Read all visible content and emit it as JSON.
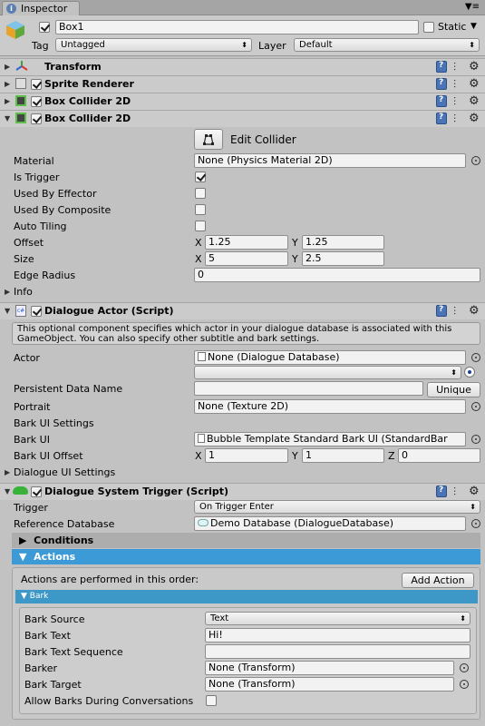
{
  "tab": {
    "title": "Inspector",
    "menu_icon": "dropdown-menu-icon"
  },
  "header": {
    "name_value": "Box1",
    "static_label": "Static",
    "tag_label": "Tag",
    "tag_value": "Untagged",
    "layer_label": "Layer",
    "layer_value": "Default"
  },
  "components": {
    "transform": "Transform",
    "sprite_renderer": "Sprite Renderer",
    "box_collider_a": "Box Collider 2D",
    "box_collider_b": "Box Collider 2D"
  },
  "collider": {
    "edit_collider": "Edit Collider",
    "material_label": "Material",
    "material_value": "None (Physics Material 2D)",
    "is_trigger_label": "Is Trigger",
    "used_by_effector_label": "Used By Effector",
    "used_by_composite_label": "Used By Composite",
    "auto_tiling_label": "Auto Tiling",
    "offset_label": "Offset",
    "offset_x": "1.25",
    "offset_y": "1.25",
    "size_label": "Size",
    "size_x": "5",
    "size_y": "2.5",
    "edge_radius_label": "Edge Radius",
    "edge_radius_value": "0",
    "info_label": "Info",
    "x": "X",
    "y": "Y",
    "z": "Z"
  },
  "actor": {
    "title": "Dialogue Actor (Script)",
    "help": "This optional component specifies which actor in your dialogue database is associated with this GameObject. You can also specify other subtitle and bark settings.",
    "actor_label": "Actor",
    "actor_value": "None (Dialogue Database)",
    "persistent_label": "Persistent Data Name",
    "unique_button": "Unique",
    "portrait_label": "Portrait",
    "portrait_value": "None (Texture 2D)",
    "bark_ui_settings": "Bark UI Settings",
    "bark_ui_label": "Bark UI",
    "bark_ui_value": "Bubble Template Standard Bark UI (StandardBar",
    "bark_ui_offset_label": "Bark UI Offset",
    "offset_x": "1",
    "offset_y": "1",
    "offset_z": "0",
    "dialogue_ui_settings": "Dialogue UI Settings"
  },
  "trigger": {
    "title": "Dialogue System Trigger (Script)",
    "trigger_label": "Trigger",
    "trigger_value": "On Trigger Enter",
    "refdb_label": "Reference Database",
    "refdb_value": "Demo Database (DialogueDatabase)",
    "conditions": "Conditions",
    "actions": "Actions",
    "actions_note": "Actions are performed in this order:",
    "add_action": "Add Action",
    "bark": "Bark",
    "bark_source_label": "Bark Source",
    "bark_source_value": "Text",
    "bark_text_label": "Bark Text",
    "bark_text_value": "Hi!",
    "bark_seq_label": "Bark Text Sequence",
    "barker_label": "Barker",
    "barker_value": "None (Transform)",
    "bark_target_label": "Bark Target",
    "bark_target_value": "None (Transform)",
    "allow_barks_label": "Allow Barks During Conversations"
  },
  "colors": {
    "accent": "#3c9ad6",
    "panel": "#c2c2c2"
  }
}
